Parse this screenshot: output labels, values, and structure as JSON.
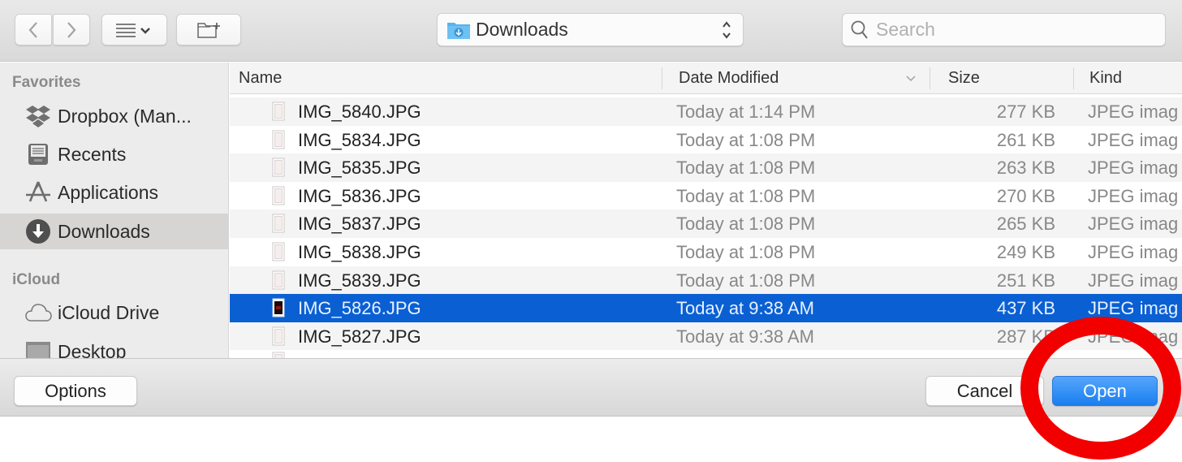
{
  "toolbar": {
    "back_icon": "chevron-left-icon",
    "forward_icon": "chevron-right-icon",
    "view_icon": "list-view-icon",
    "new_folder_icon": "new-folder-icon",
    "location": "Downloads",
    "location_icon": "downloads-folder-icon",
    "search_placeholder": "Search",
    "search_value": ""
  },
  "sidebar": {
    "sections": [
      {
        "title": "Favorites",
        "items": [
          {
            "label": "Dropbox (Man...",
            "icon": "dropbox-icon",
            "selected": false
          },
          {
            "label": "Recents",
            "icon": "recents-icon",
            "selected": false
          },
          {
            "label": "Applications",
            "icon": "applications-icon",
            "selected": false
          },
          {
            "label": "Downloads",
            "icon": "downloads-icon",
            "selected": true
          }
        ]
      },
      {
        "title": "iCloud",
        "items": [
          {
            "label": "iCloud Drive",
            "icon": "cloud-icon",
            "selected": false
          },
          {
            "label": "Desktop",
            "icon": "desktop-icon",
            "selected": false
          }
        ]
      }
    ]
  },
  "filelist": {
    "columns": {
      "name": "Name",
      "date": "Date Modified",
      "size": "Size",
      "kind": "Kind"
    },
    "sort_column": "Date Modified",
    "sort_direction": "descending",
    "rows": [
      {
        "name": "IMG_5840.JPG",
        "date": "Today at 1:14 PM",
        "size": "277 KB",
        "kind": "JPEG imag",
        "selected": false
      },
      {
        "name": "IMG_5834.JPG",
        "date": "Today at 1:08 PM",
        "size": "261 KB",
        "kind": "JPEG imag",
        "selected": false
      },
      {
        "name": "IMG_5835.JPG",
        "date": "Today at 1:08 PM",
        "size": "263 KB",
        "kind": "JPEG imag",
        "selected": false
      },
      {
        "name": "IMG_5836.JPG",
        "date": "Today at 1:08 PM",
        "size": "270 KB",
        "kind": "JPEG imag",
        "selected": false
      },
      {
        "name": "IMG_5837.JPG",
        "date": "Today at 1:08 PM",
        "size": "265 KB",
        "kind": "JPEG imag",
        "selected": false
      },
      {
        "name": "IMG_5838.JPG",
        "date": "Today at 1:08 PM",
        "size": "249 KB",
        "kind": "JPEG imag",
        "selected": false
      },
      {
        "name": "IMG_5839.JPG",
        "date": "Today at 1:08 PM",
        "size": "251 KB",
        "kind": "JPEG imag",
        "selected": false
      },
      {
        "name": "IMG_5826.JPG",
        "date": "Today at 9:38 AM",
        "size": "437 KB",
        "kind": "JPEG imag",
        "selected": true
      },
      {
        "name": "IMG_5827.JPG",
        "date": "Today at 9:38 AM",
        "size": "287 KB",
        "kind": "JPEG imag",
        "selected": false
      },
      {
        "name": "",
        "date": "",
        "size": "",
        "kind": "",
        "selected": false
      }
    ]
  },
  "bottombar": {
    "options_label": "Options",
    "cancel_label": "Cancel",
    "open_label": "Open"
  },
  "colors": {
    "selection": "#0a60d3",
    "primary_button": "#1a7ef0",
    "annotation": "#f20000"
  }
}
